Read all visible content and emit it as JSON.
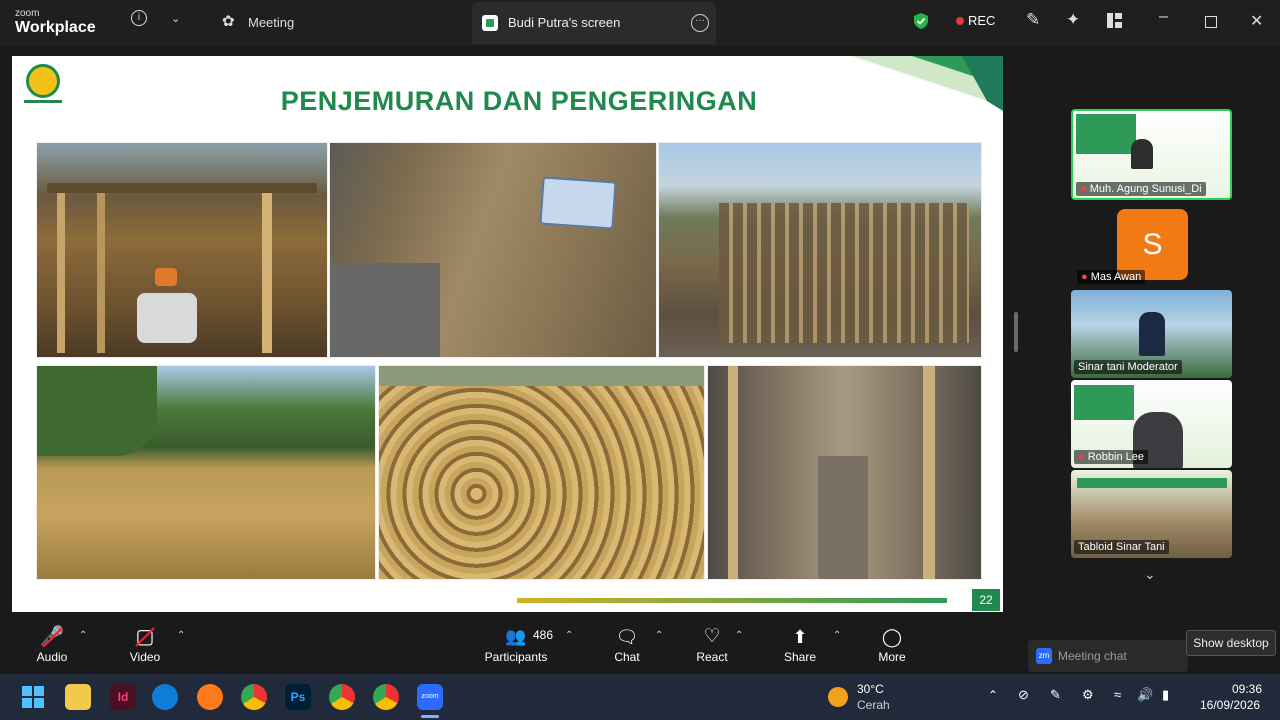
{
  "app": {
    "brand_small": "zoom",
    "brand_big": "Workplace",
    "meeting_label": "Meeting",
    "screen_tab": "Budi Putra's screen",
    "rec_label": "REC"
  },
  "slide": {
    "title": "PENJEMURAN DAN PENGERINGAN",
    "page_number": "22"
  },
  "sidebar": {
    "participants": [
      {
        "name": "Muh. Agung Sunusi_Di"
      },
      {
        "name": "Mas Awan",
        "initial": "S"
      },
      {
        "name": "Sinar tani Moderator"
      },
      {
        "name": "Robbin Lee"
      },
      {
        "name": "Tabloid Sinar Tani"
      }
    ]
  },
  "toolbar": {
    "audio": "Audio",
    "video": "Video",
    "participants": "Participants",
    "participant_count": "486",
    "chat": "Chat",
    "react": "React",
    "share": "Share",
    "more": "More",
    "meeting_chat": "Meeting chat",
    "show_desktop": "Show desktop"
  },
  "taskbar": {
    "weather_temp": "30°C",
    "weather_cond": "Cerah",
    "time": "09:36",
    "date": "16/09/2026"
  }
}
